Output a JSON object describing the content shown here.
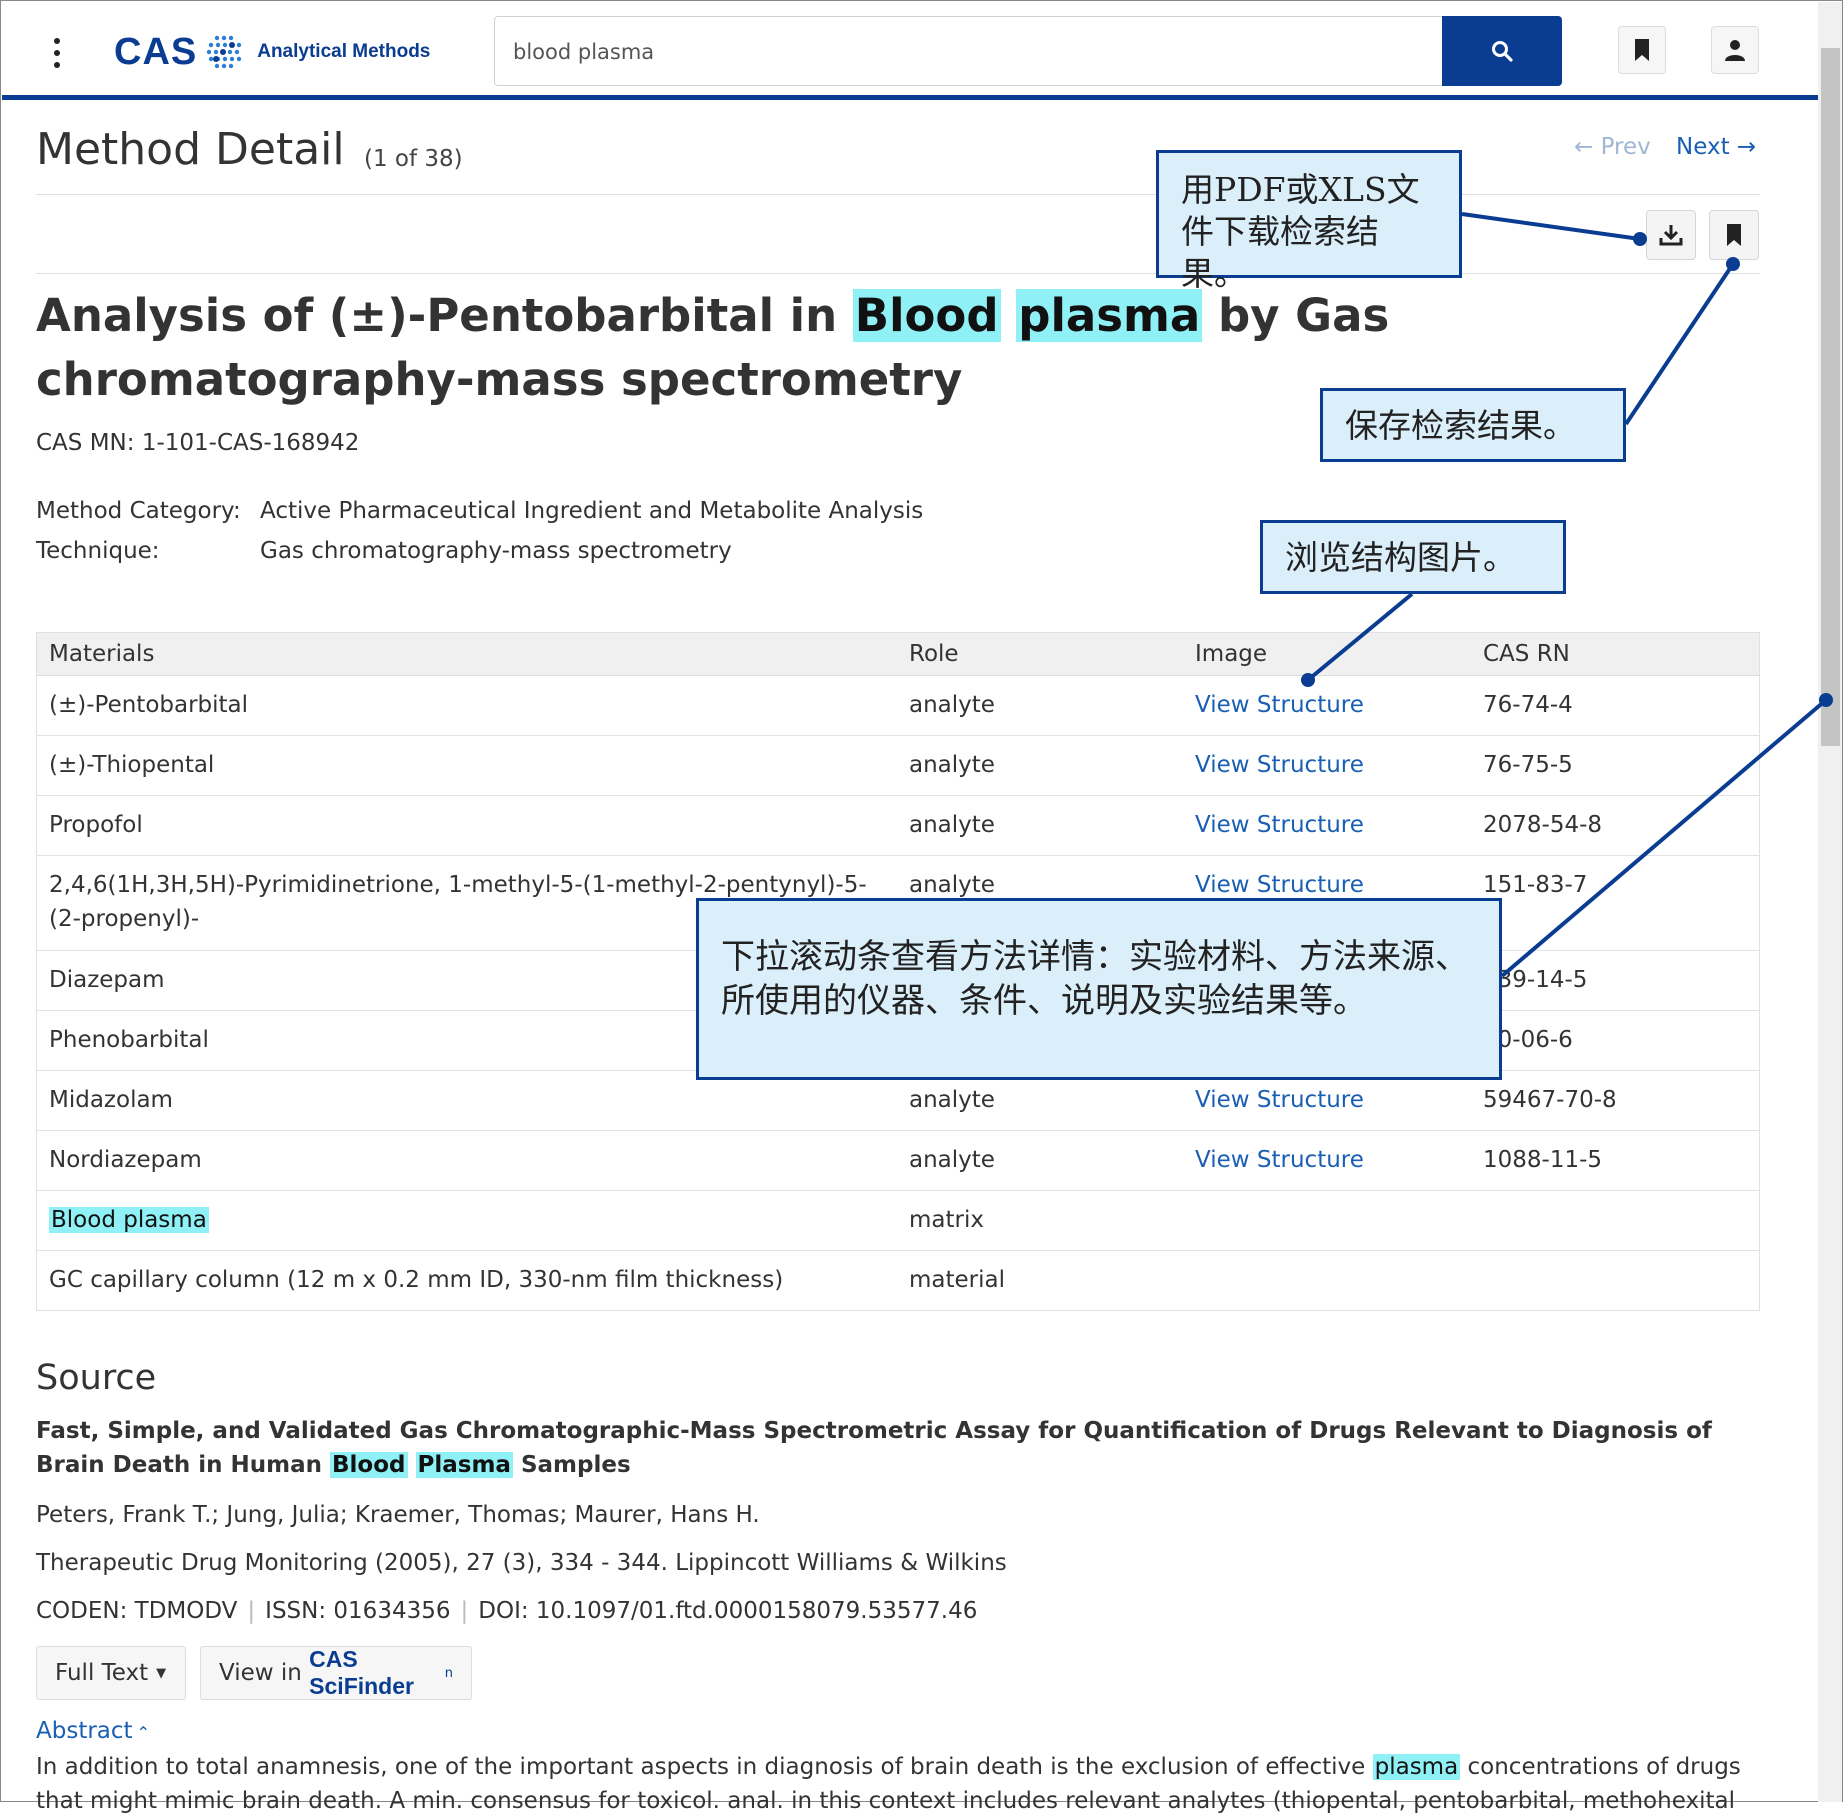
{
  "header": {
    "logo_text": "CAS",
    "logo_subtitle": "Analytical Methods",
    "search_value": "blood plasma"
  },
  "page": {
    "title": "Method Detail",
    "count": "(1 of 38)",
    "prev": "← Prev",
    "next": "Next →"
  },
  "method": {
    "title_before": "Analysis of (±)-Pentobarbital in ",
    "title_hl1": "Blood",
    "title_hl2": "plasma",
    "title_after": " by Gas chromatography-mass spectrometry",
    "cas_mn": "CAS MN: 1-101-CAS-168942",
    "category_label": "Method Category:",
    "category_value": "Active Pharmaceutical Ingredient and Metabolite Analysis",
    "technique_label": "Technique:",
    "technique_value": "Gas chromatography-mass spectrometry"
  },
  "materials": {
    "headers": [
      "Materials",
      "Role",
      "Image",
      "CAS RN"
    ],
    "rows": [
      {
        "name": "(±)-Pentobarbital",
        "role": "analyte",
        "image": "View Structure",
        "casrn": "76-74-4"
      },
      {
        "name": "(±)-Thiopental",
        "role": "analyte",
        "image": "View Structure",
        "casrn": "76-75-5"
      },
      {
        "name": "Propofol",
        "role": "analyte",
        "image": "View Structure",
        "casrn": "2078-54-8"
      },
      {
        "name": "2,4,6(1H,3H,5H)-Pyrimidinetrione, 1-methyl-5-(1-methyl-2-pentynyl)-5-(2-propenyl)-",
        "role": "analyte",
        "image": "View Structure",
        "casrn": "151-83-7"
      },
      {
        "name": "Diazepam",
        "role": "",
        "image": "",
        "casrn": "439-14-5"
      },
      {
        "name": "Phenobarbital",
        "role": "",
        "image": "",
        "casrn": "50-06-6"
      },
      {
        "name": "Midazolam",
        "role": "analyte",
        "image": "View Structure",
        "casrn": "59467-70-8"
      },
      {
        "name": "Nordiazepam",
        "role": "analyte",
        "image": "View Structure",
        "casrn": "1088-11-5"
      },
      {
        "name": "Blood plasma",
        "role": "matrix",
        "image": "",
        "casrn": ""
      },
      {
        "name": "GC capillary column (12 m x 0.2 mm ID, 330-nm film thickness)",
        "role": "material",
        "image": "",
        "casrn": ""
      }
    ]
  },
  "source": {
    "heading": "Source",
    "title_a": "Fast, Simple, and Validated Gas Chromatographic-Mass Spectrometric Assay for Quantification of Drugs Relevant to Diagnosis of Brain Death in Human ",
    "title_hl1": "Blood",
    "title_hl2": "Plasma",
    "title_b": " Samples",
    "authors": "Peters, Frank T.; Jung, Julia; Kraemer, Thomas; Maurer, Hans H.",
    "journal": "Therapeutic Drug Monitoring (2005), 27 (3), 334 - 344. Lippincott Williams & Wilkins",
    "coden": "CODEN: TDMODV",
    "issn": "ISSN: 01634356",
    "doi": "DOI: 10.1097/01.ftd.0000158079.53577.46",
    "full_text_btn": "Full Text",
    "view_in": "View in ",
    "scifinder": "CAS SciFinder",
    "scifinder_sup": "n",
    "abstract_label": "Abstract",
    "abstract_a": "In addition to total anamnesis, one of the important aspects in diagnosis of brain death is the exclusion of effective ",
    "abstract_hl": "plasma",
    "abstract_b": " concentrations of drugs that might mimic brain death. A min. consensus for toxicol. anal. in this context includes relevant analytes (thiopental, pentobarbital, methohexital"
  },
  "callouts": {
    "download": "用PDF或XLS文件下载检索结果。",
    "save": "保存检索结果。",
    "structure": "浏览结构图片。",
    "scroll": "下拉滚动条查看方法详情：实验材料、方法来源、所使用的仪器、条件、说明及实验结果等。"
  },
  "colors": {
    "brand": "#0a3d91",
    "highlight": "#8ff0f6",
    "link": "#1a5fb4",
    "callout_bg": "#dbeffa"
  }
}
